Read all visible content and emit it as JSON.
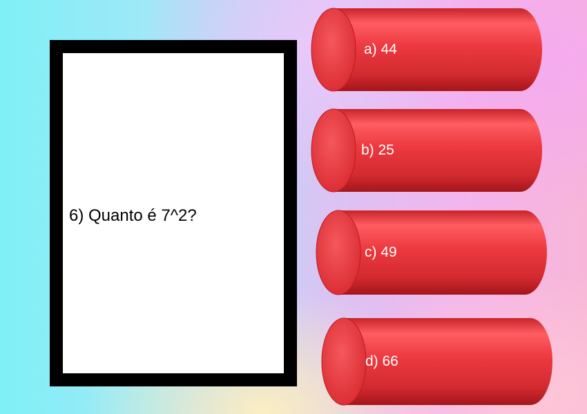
{
  "question": {
    "text": "6) Quanto é 7^2?"
  },
  "options": [
    {
      "label": "a) 44"
    },
    {
      "label": "b) 25"
    },
    {
      "label": "c) 49"
    },
    {
      "label": "d) 66"
    }
  ],
  "colors": {
    "cylinder_body": "#e8333a",
    "cylinder_highlight": "#ff6a6e",
    "cylinder_shadow": "#a8181d",
    "cylinder_cap": "#ee4b51",
    "card_border": "#000000",
    "card_fill": "#ffffff"
  }
}
